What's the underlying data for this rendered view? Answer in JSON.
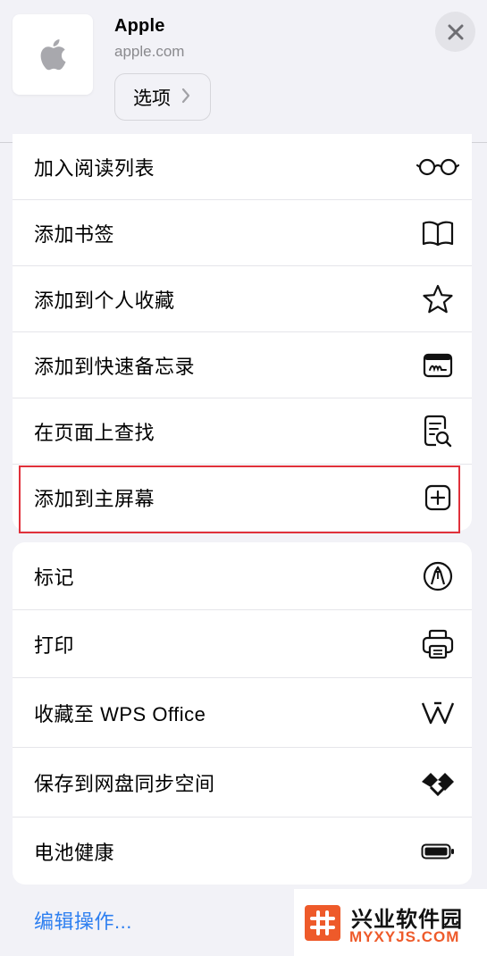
{
  "header": {
    "title": "Apple",
    "url": "apple.com",
    "options_label": "选项",
    "app_icon": "apple-logo-icon",
    "close_icon": "close-icon"
  },
  "actions_primary": [
    {
      "label": "加入阅读列表",
      "icon": "glasses-icon"
    },
    {
      "label": "添加书签",
      "icon": "book-icon"
    },
    {
      "label": "添加到个人收藏",
      "icon": "star-icon"
    },
    {
      "label": "添加到快速备忘录",
      "icon": "quick-note-icon"
    },
    {
      "label": "在页面上查找",
      "icon": "find-on-page-icon"
    },
    {
      "label": "添加到主屏幕",
      "icon": "plus-square-icon"
    }
  ],
  "actions_secondary": [
    {
      "label": "标记",
      "icon": "markup-icon"
    },
    {
      "label": "打印",
      "icon": "printer-icon"
    },
    {
      "label": "收藏至 WPS Office",
      "icon": "wps-icon"
    },
    {
      "label": "保存到网盘同步空间",
      "icon": "sync-space-icon"
    },
    {
      "label": "电池健康",
      "icon": "battery-icon"
    }
  ],
  "footer": {
    "edit_actions": "编辑操作..."
  },
  "watermark": {
    "name": "兴业软件园",
    "domain": "MYXYJS.COM"
  },
  "colors": {
    "highlight": "#e0313b",
    "link": "#2d7ff0",
    "background": "#f2f2f7",
    "watermark_accent": "#ee5a2a"
  }
}
